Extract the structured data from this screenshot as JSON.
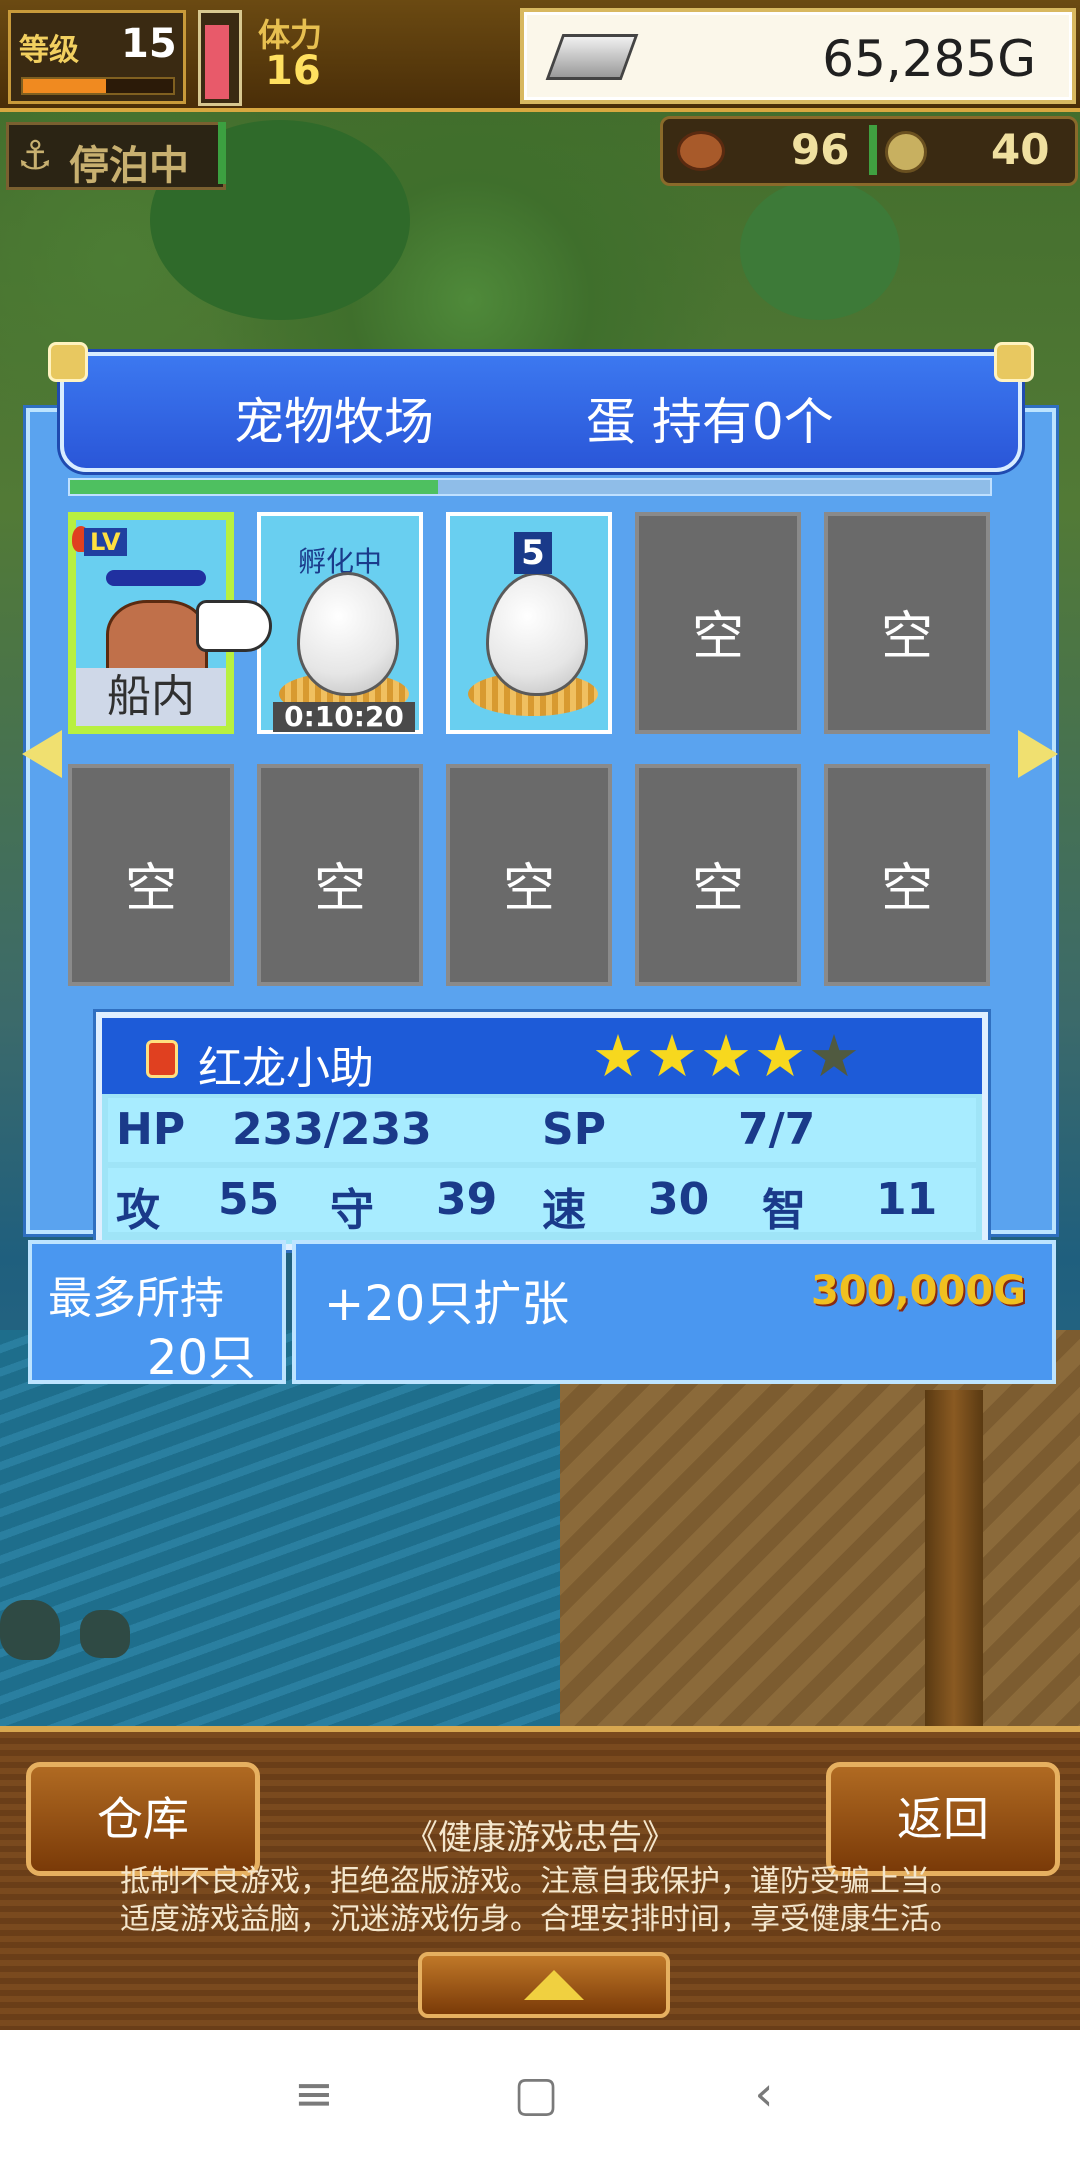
{
  "hud": {
    "level_label": "等级",
    "level_value": "15",
    "xp_fraction": 0.55,
    "hp_fraction": 0.95,
    "stamina_label": "体力",
    "stamina_value": "16",
    "money": "65,285G"
  },
  "status": {
    "docked_label": "停泊中",
    "food_value": "96",
    "coin_value": "40"
  },
  "panel": {
    "title": "宠物牧场",
    "egg_count_label": "蛋 持有0个",
    "progress_fraction": 0.4
  },
  "slots": {
    "pet": {
      "level_badge": "LV",
      "location": "船内"
    },
    "hatching": {
      "label": "孵化中",
      "timer": "0:10:20"
    },
    "egg": {
      "number": "5"
    },
    "empty_label": "空"
  },
  "pet_info": {
    "name": "红龙小助",
    "stars_on": 4,
    "stars_total": 5,
    "hp_label": "HP",
    "hp_value": "233/233",
    "sp_label": "SP",
    "sp_value": "7/7",
    "atk_label": "攻",
    "atk_value": "55",
    "def_label": "守",
    "def_value": "39",
    "spd_label": "速",
    "spd_value": "30",
    "int_label": "智",
    "int_value": "11"
  },
  "capacity": {
    "label": "最多所持",
    "value": "20只"
  },
  "expand": {
    "label": "+20只扩张",
    "price": "300,000G"
  },
  "bottom": {
    "warehouse_label": "仓库",
    "back_label": "返回",
    "notice_title": "《健康游戏忠告》",
    "notice_line1": "抵制不良游戏，拒绝盗版游戏。注意自我保护，谨防受骗上当。",
    "notice_line2": "适度游戏益脑，沉迷游戏伤身。合理安排时间，享受健康生活。"
  },
  "colors": {
    "panel_blue": "#5aa3ef",
    "title_blue": "#2a56d8",
    "slot_empty": "#6a6a6a",
    "star_gold": "#f7d81e",
    "price_gold": "#f0c020"
  },
  "icons": {
    "money": "silver-ingot-icon",
    "docked": "anchor-icon",
    "food": "meat-icon",
    "coin": "coin-icon",
    "nav_menu": "menu-icon",
    "nav_home": "home-icon",
    "nav_back": "back-icon"
  }
}
